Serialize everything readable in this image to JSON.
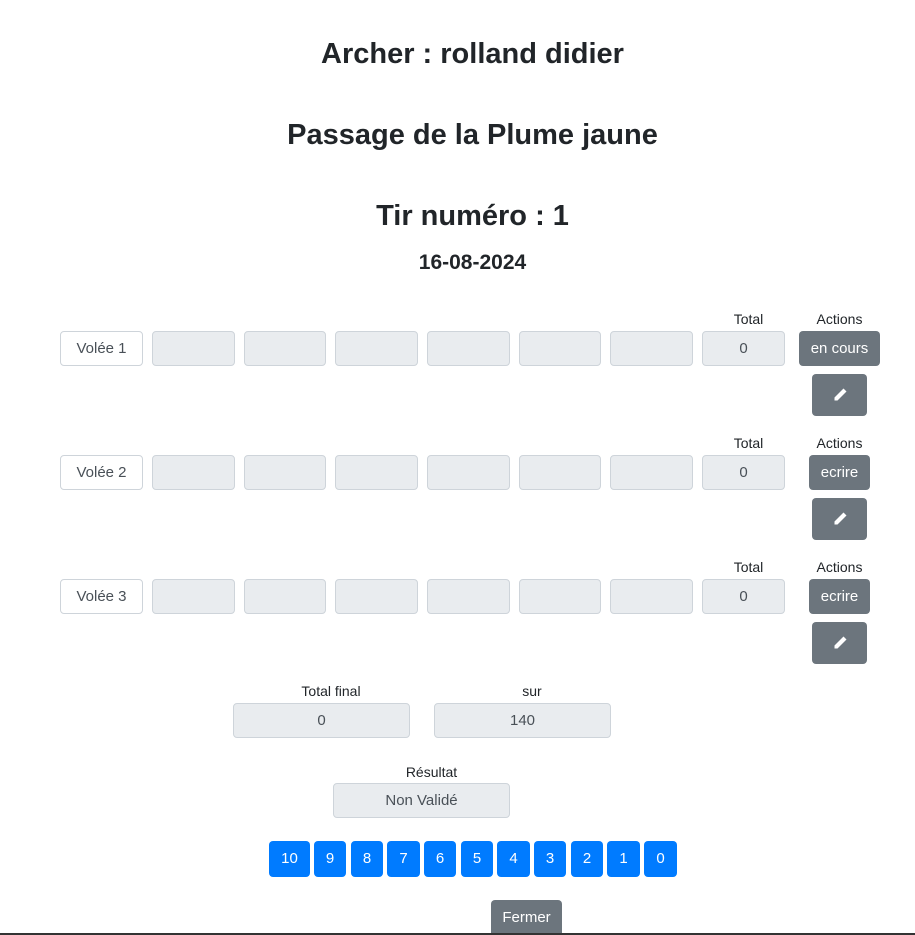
{
  "header": {
    "archer": "Archer : rolland didier",
    "passage": "Passage de la Plume jaune",
    "tir": "Tir numéro : 1",
    "date": "16-08-2024"
  },
  "volees": [
    {
      "label": "Volée 1",
      "total_label": "Total",
      "total": "0",
      "actions_label": "Actions",
      "action_button": "en cours"
    },
    {
      "label": "Volée 2",
      "total_label": "Total",
      "total": "0",
      "actions_label": "Actions",
      "action_button": "ecrire"
    },
    {
      "label": "Volée 3",
      "total_label": "Total",
      "total": "0",
      "actions_label": "Actions",
      "action_button": "ecrire"
    }
  ],
  "summary": {
    "total_final_label": "Total final",
    "total_final": "0",
    "sur_label": "sur",
    "sur": "140",
    "resultat_label": "Résultat",
    "resultat": "Non Validé"
  },
  "score_buttons": [
    "10",
    "9",
    "8",
    "7",
    "6",
    "5",
    "4",
    "3",
    "2",
    "1",
    "0"
  ],
  "close_button": "Fermer",
  "colors": {
    "primary": "#007bff",
    "secondary": "#6c757d",
    "input_bg": "#e9ecef"
  },
  "icons": {
    "edit": "pencil-icon"
  }
}
